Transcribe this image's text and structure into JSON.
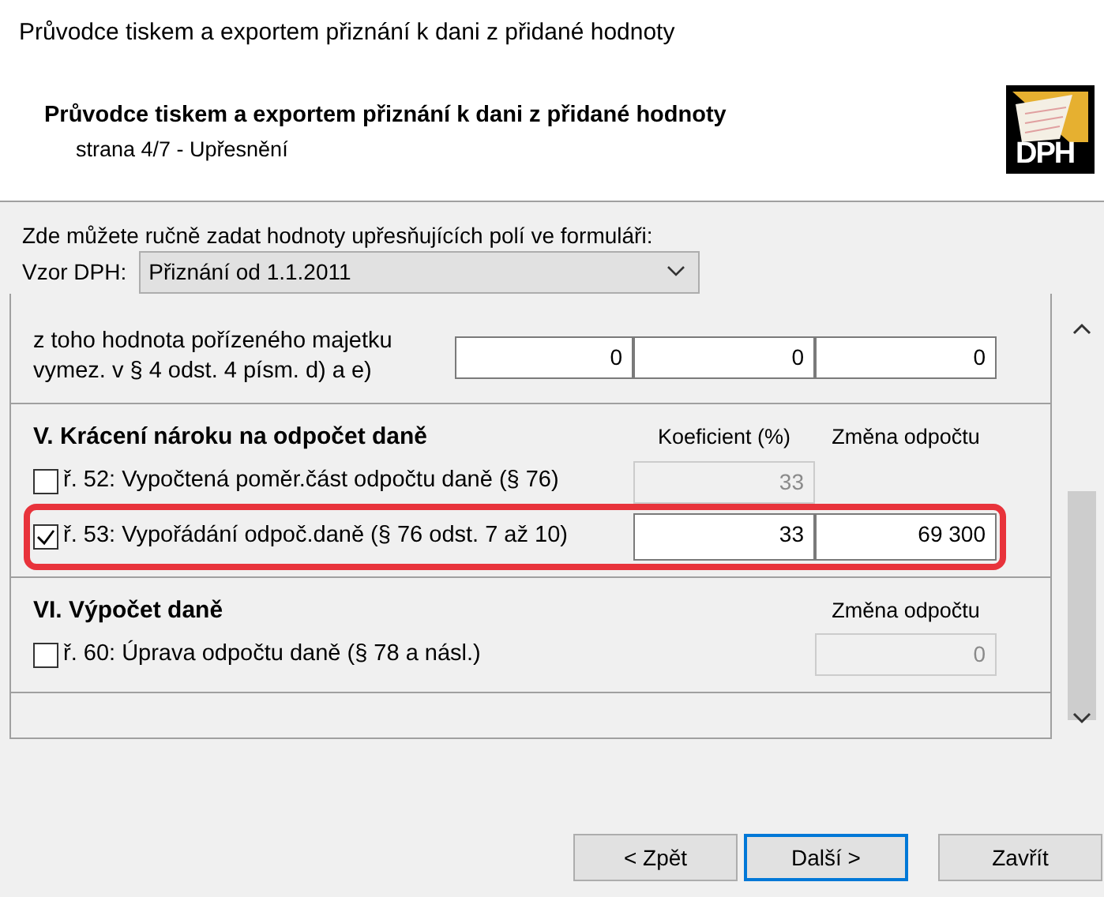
{
  "window": {
    "title": "Průvodce tiskem a exportem přiznání k dani z přidané hodnoty"
  },
  "header": {
    "title": "Průvodce tiskem a exportem přiznání k dani z přidané hodnoty",
    "subtitle": "strana 4/7 - Upřesnění",
    "logo_text": "DPH"
  },
  "intro": "Zde můžete ručně zadat hodnoty upřesňujících polí ve formuláři:",
  "template": {
    "label": "Vzor DPH:",
    "value": "Přiznání od 1.1.2011"
  },
  "sections": [
    {
      "rows": [
        {
          "kind": "plain",
          "label": "z toho hodnota pořízeného majetku\nvymez. v § 4 odst. 4 písm. d) a e)",
          "highlighted": false,
          "fields": [
            {
              "kind": "base",
              "value": "0",
              "disabled": false
            },
            {
              "kind": "full",
              "value": "0",
              "disabled": false
            },
            {
              "kind": "reduced",
              "value": "0",
              "disabled": false
            }
          ]
        }
      ]
    },
    {
      "title": "V. Krácení nároku na odpočet daně",
      "columns": [
        {
          "kind": "coefficient",
          "label": "Koeficient (%)"
        },
        {
          "kind": "change",
          "label": "Změna odpočtu"
        }
      ],
      "rows": [
        {
          "kind": "check",
          "label": "ř. 52: Vypočtená poměr.část odpočtu daně (§ 76)",
          "checked": false,
          "highlighted": false,
          "fields": [
            {
              "kind": "coefficient",
              "value": "33",
              "disabled": true
            }
          ]
        },
        {
          "kind": "check",
          "label": "ř. 53: Vypořádání odpoč.daně (§ 76 odst. 7 až 10)",
          "checked": true,
          "highlighted": true,
          "fields": [
            {
              "kind": "coefficient",
              "value": "33",
              "disabled": false
            },
            {
              "kind": "change",
              "value": "69 300",
              "disabled": false
            }
          ]
        }
      ]
    },
    {
      "title": "VI. Výpočet daně",
      "columns": [
        {
          "kind": "change",
          "label": "Změna odpočtu"
        }
      ],
      "rows": [
        {
          "kind": "check",
          "label": "ř. 60: Úprava odpočtu daně (§ 78 a násl.)",
          "checked": false,
          "highlighted": false,
          "fields": [
            {
              "kind": "change",
              "value": "0",
              "disabled": true
            }
          ]
        }
      ]
    }
  ],
  "buttons": [
    {
      "label": "< Zpět",
      "default": false
    },
    {
      "label": "Další >",
      "default": true
    },
    {
      "label": "Zavřít",
      "default": false
    }
  ]
}
